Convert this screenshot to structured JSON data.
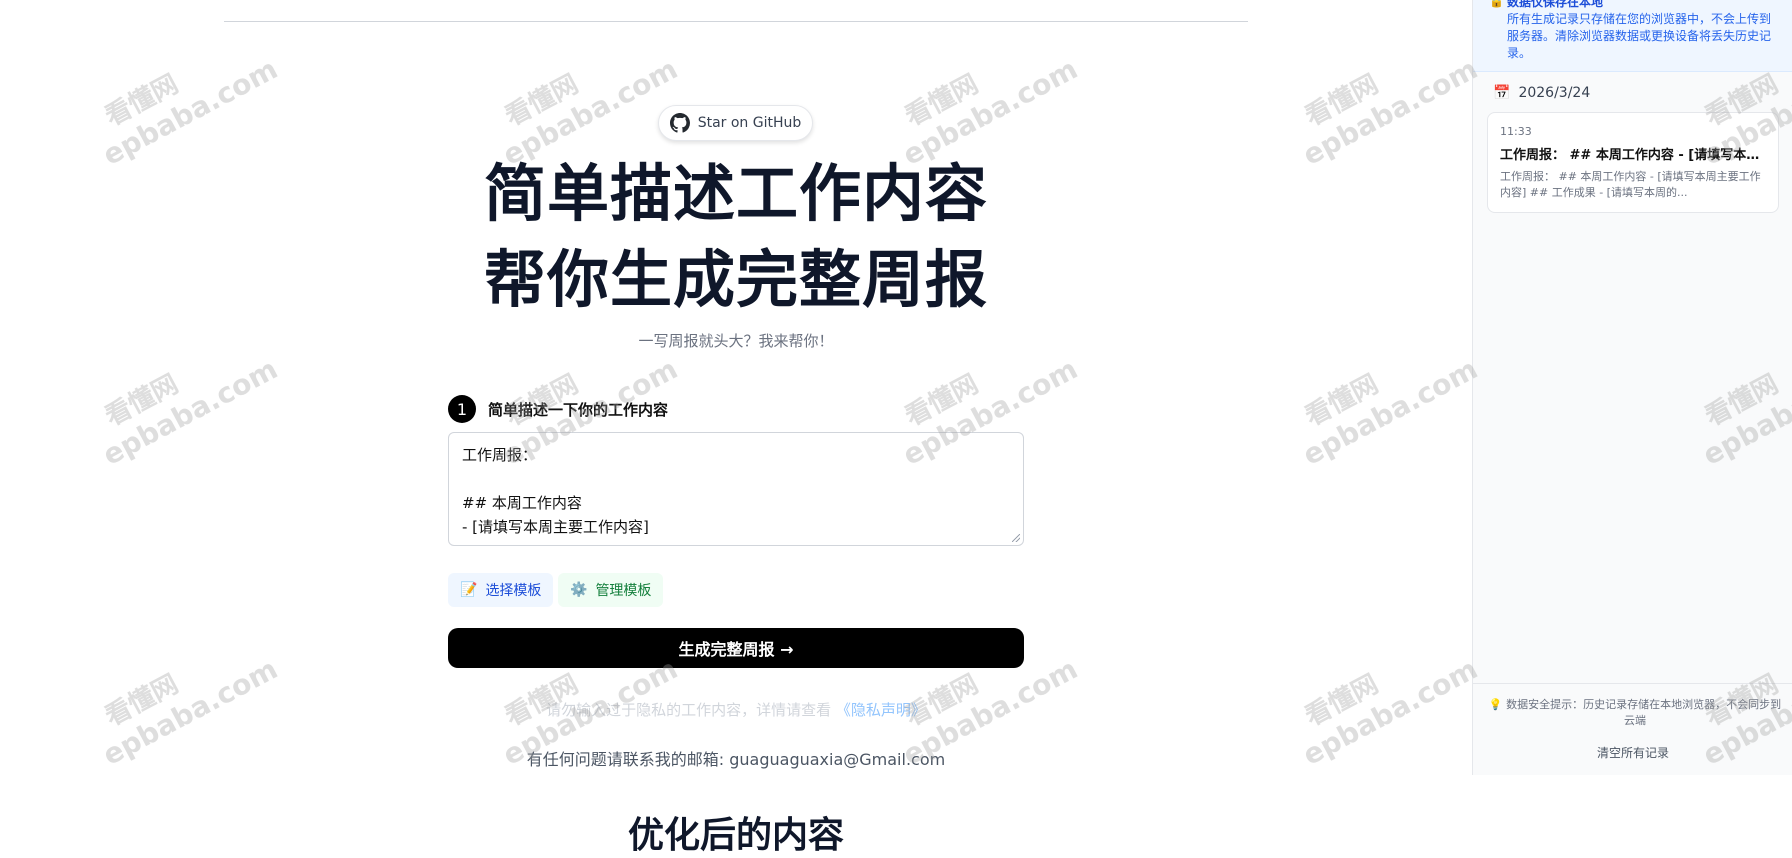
{
  "github_button": {
    "label": "Star on GitHub",
    "icon": "github-icon"
  },
  "hero": {
    "line1": "简单描述工作内容",
    "line2": "帮你生成完整周报"
  },
  "subtitle": "一写周报就头大？我来帮你！",
  "step1": {
    "number": "1",
    "label": "简单描述一下你的工作内容"
  },
  "input": {
    "value": "工作周报：\n\n## 本周工作内容\n- [请填写本周主要工作内容]"
  },
  "template_buttons": {
    "select": {
      "icon": "📝",
      "label": "选择模板"
    },
    "manage": {
      "icon": "⚙️",
      "label": "管理模板"
    }
  },
  "generate_button": {
    "label": "生成完整周报 →"
  },
  "privacy": {
    "text": "请勿输入过于隐私的工作内容，详情请查看",
    "link": "《隐私声明》"
  },
  "contact": "有任何问题请联系我的邮箱: guaguaguaxia@Gmail.com",
  "result_title": "优化后的内容",
  "sidebar": {
    "notice_icon": "🔒",
    "notice_title": "数据仅保存在本地",
    "notice_text": "所有生成记录只存储在您的浏览器中，不会上传到服务器。清除浏览器数据或更换设备将丢失历史记录。",
    "date_icon": "📅",
    "date": "2026/3/24",
    "records": [
      {
        "time": "11:33",
        "title": "工作周报： ## 本周工作内容 - [请填写本周主要工作内容]",
        "preview": "工作周报： ## 本周工作内容 - [请填写本周主要工作内容] ## 工作成果 - [请填写本周的..."
      }
    ],
    "tip_icon": "💡",
    "tip": "数据安全提示：历史记录存储在本地浏览器，不会同步到云端",
    "clear_label": "清空所有记录"
  },
  "watermark": {
    "line1": "看懂网",
    "line2": "epbaba.com"
  }
}
